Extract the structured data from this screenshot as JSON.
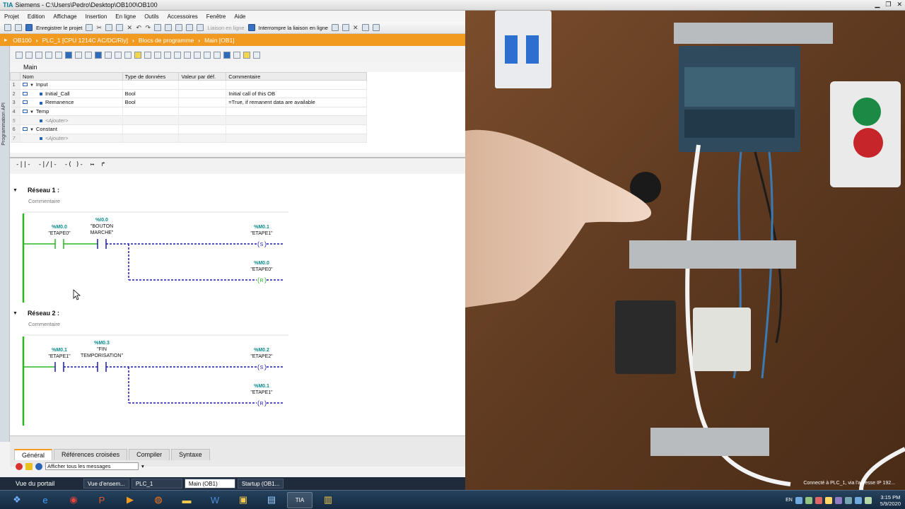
{
  "window": {
    "title": "Siemens - C:\\Users\\Pedro\\Desktop\\OB100\\OB100"
  },
  "menu": [
    "Projet",
    "Edition",
    "Affichage",
    "Insertion",
    "En ligne",
    "Outils",
    "Accessoires",
    "Fenêtre",
    "Aide"
  ],
  "toolbar": {
    "save_label": "Enregistrer le projet",
    "go_online_label": "Liaison en ligne",
    "go_offline_label": "Interrompre la liaison en ligne"
  },
  "breadcrumb": [
    "OB100",
    "PLC_1 [CPU 1214C AC/DC/Rly]",
    "Blocs de programme",
    "Main [OB1]"
  ],
  "side_tab": "Programmation API",
  "interface": {
    "block_name": "Main",
    "columns": [
      "Nom",
      "Type de données",
      "Valeur par déf.",
      "Commentaire"
    ],
    "rows": [
      {
        "num": "1",
        "name": "Input",
        "type": "",
        "default": "",
        "comment": ""
      },
      {
        "num": "2",
        "name": "Initial_Call",
        "type": "Bool",
        "default": "",
        "comment": "Initial call of this OB"
      },
      {
        "num": "3",
        "name": "Remanence",
        "type": "Bool",
        "default": "",
        "comment": "=True, if remanent data are available"
      },
      {
        "num": "4",
        "name": "Temp",
        "type": "",
        "default": "",
        "comment": ""
      },
      {
        "num": "5",
        "name": "<Ajouter>",
        "type": "",
        "default": "",
        "comment": ""
      },
      {
        "num": "6",
        "name": "Constant",
        "type": "",
        "default": "",
        "comment": ""
      },
      {
        "num": "7",
        "name": "<Ajouter>",
        "type": "",
        "default": "",
        "comment": ""
      }
    ]
  },
  "ladder_toolbar": [
    "-||-",
    "-|/|-",
    "-( )-",
    "↦",
    "↱"
  ],
  "networks": [
    {
      "title": "Réseau 1 :",
      "comment": "Commentaire",
      "contact1": {
        "addr": "%M0.0",
        "tag": "\"ETAPE0\""
      },
      "contact2": {
        "addr": "%I0.0",
        "tag": "\"BOUTON",
        "tag2": "MARCHE\""
      },
      "coil1": {
        "addr": "%M0.1",
        "tag": "\"ETAPE1\"",
        "type": "S"
      },
      "coil2": {
        "addr": "%M0.0",
        "tag": "\"ETAPE0\"",
        "type": "R"
      }
    },
    {
      "title": "Réseau 2 :",
      "comment": "Commentaire",
      "contact1": {
        "addr": "%M0.1",
        "tag": "\"ETAPE1\""
      },
      "contact2": {
        "addr": "%M0.3",
        "tag": "\"FIN",
        "tag2": "TEMPORISATION\""
      },
      "coil1": {
        "addr": "%M0.2",
        "tag": "\"ETAPE2\"",
        "type": "S"
      },
      "coil2": {
        "addr": "%M0.1",
        "tag": "\"ETAPE1\"",
        "type": "R"
      }
    }
  ],
  "bottom_tabs": [
    "Général",
    "Références croisées",
    "Compiler",
    "Syntaxe"
  ],
  "message_filter": "Afficher tous les messages",
  "portal": {
    "label": "Vue du portail",
    "tabs": [
      "Vue d'ensem...",
      "PLC_1",
      "Main (OB1)",
      "Startup (OB1..."
    ]
  },
  "taskbar": {
    "tray_status": "Connecté à PLC_1, via l'adresse IP 192...",
    "lang": "EN",
    "time": "3:15 PM",
    "date": "5/9/2020"
  },
  "colors": {
    "accent_orange": "#f29a1f",
    "ladder_energized": "#2bb51f",
    "ladder_unpowered": "#1b1bb5",
    "tag_addr": "#0a8a8a"
  }
}
